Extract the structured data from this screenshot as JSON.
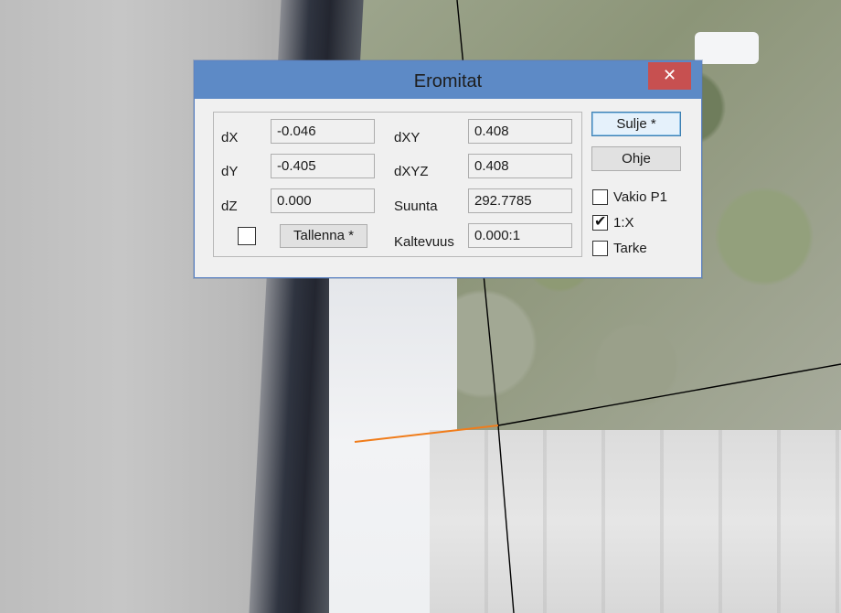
{
  "dialog": {
    "title": "Eromitat",
    "close_glyph": "✕",
    "rows": {
      "dx": {
        "label": "dX",
        "value": "-0.046"
      },
      "dy": {
        "label": "dY",
        "value": "-0.405"
      },
      "dz": {
        "label": "dZ",
        "value": "0.000"
      },
      "dxy": {
        "label": "dXY",
        "value": "0.408"
      },
      "dxyz": {
        "label": "dXYZ",
        "value": "0.408"
      },
      "suunta": {
        "label": "Suunta",
        "value": "292.7785"
      },
      "kaltevuus": {
        "label": "Kaltevuus",
        "value": "0.000:1"
      }
    },
    "save_button": "Tallenna *",
    "save_checkbox_checked": false,
    "close_button": "Sulje *",
    "help_button": "Ohje",
    "options": [
      {
        "label": "Vakio P1",
        "checked": false
      },
      {
        "label": "1:X",
        "checked": true
      },
      {
        "label": "Tarke",
        "checked": false
      }
    ],
    "check_glyph": "✔"
  },
  "colors": {
    "titlebar": "#5d8ac6",
    "close": "#c75050",
    "measure_line": "#f07c1a"
  }
}
